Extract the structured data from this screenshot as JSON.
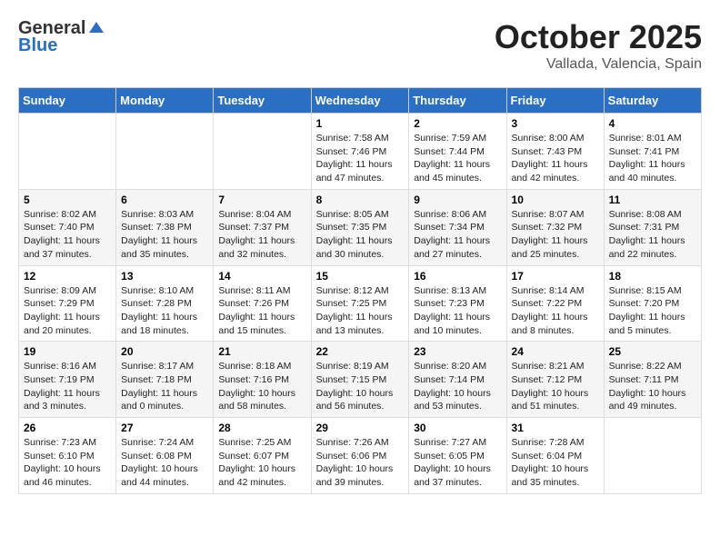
{
  "header": {
    "logo_line1": "General",
    "logo_line2": "Blue",
    "month": "October 2025",
    "location": "Vallada, Valencia, Spain"
  },
  "days_of_week": [
    "Sunday",
    "Monday",
    "Tuesday",
    "Wednesday",
    "Thursday",
    "Friday",
    "Saturday"
  ],
  "weeks": [
    [
      {
        "num": "",
        "sunrise": "",
        "sunset": "",
        "daylight": ""
      },
      {
        "num": "",
        "sunrise": "",
        "sunset": "",
        "daylight": ""
      },
      {
        "num": "",
        "sunrise": "",
        "sunset": "",
        "daylight": ""
      },
      {
        "num": "1",
        "sunrise": "Sunrise: 7:58 AM",
        "sunset": "Sunset: 7:46 PM",
        "daylight": "Daylight: 11 hours and 47 minutes."
      },
      {
        "num": "2",
        "sunrise": "Sunrise: 7:59 AM",
        "sunset": "Sunset: 7:44 PM",
        "daylight": "Daylight: 11 hours and 45 minutes."
      },
      {
        "num": "3",
        "sunrise": "Sunrise: 8:00 AM",
        "sunset": "Sunset: 7:43 PM",
        "daylight": "Daylight: 11 hours and 42 minutes."
      },
      {
        "num": "4",
        "sunrise": "Sunrise: 8:01 AM",
        "sunset": "Sunset: 7:41 PM",
        "daylight": "Daylight: 11 hours and 40 minutes."
      }
    ],
    [
      {
        "num": "5",
        "sunrise": "Sunrise: 8:02 AM",
        "sunset": "Sunset: 7:40 PM",
        "daylight": "Daylight: 11 hours and 37 minutes."
      },
      {
        "num": "6",
        "sunrise": "Sunrise: 8:03 AM",
        "sunset": "Sunset: 7:38 PM",
        "daylight": "Daylight: 11 hours and 35 minutes."
      },
      {
        "num": "7",
        "sunrise": "Sunrise: 8:04 AM",
        "sunset": "Sunset: 7:37 PM",
        "daylight": "Daylight: 11 hours and 32 minutes."
      },
      {
        "num": "8",
        "sunrise": "Sunrise: 8:05 AM",
        "sunset": "Sunset: 7:35 PM",
        "daylight": "Daylight: 11 hours and 30 minutes."
      },
      {
        "num": "9",
        "sunrise": "Sunrise: 8:06 AM",
        "sunset": "Sunset: 7:34 PM",
        "daylight": "Daylight: 11 hours and 27 minutes."
      },
      {
        "num": "10",
        "sunrise": "Sunrise: 8:07 AM",
        "sunset": "Sunset: 7:32 PM",
        "daylight": "Daylight: 11 hours and 25 minutes."
      },
      {
        "num": "11",
        "sunrise": "Sunrise: 8:08 AM",
        "sunset": "Sunset: 7:31 PM",
        "daylight": "Daylight: 11 hours and 22 minutes."
      }
    ],
    [
      {
        "num": "12",
        "sunrise": "Sunrise: 8:09 AM",
        "sunset": "Sunset: 7:29 PM",
        "daylight": "Daylight: 11 hours and 20 minutes."
      },
      {
        "num": "13",
        "sunrise": "Sunrise: 8:10 AM",
        "sunset": "Sunset: 7:28 PM",
        "daylight": "Daylight: 11 hours and 18 minutes."
      },
      {
        "num": "14",
        "sunrise": "Sunrise: 8:11 AM",
        "sunset": "Sunset: 7:26 PM",
        "daylight": "Daylight: 11 hours and 15 minutes."
      },
      {
        "num": "15",
        "sunrise": "Sunrise: 8:12 AM",
        "sunset": "Sunset: 7:25 PM",
        "daylight": "Daylight: 11 hours and 13 minutes."
      },
      {
        "num": "16",
        "sunrise": "Sunrise: 8:13 AM",
        "sunset": "Sunset: 7:23 PM",
        "daylight": "Daylight: 11 hours and 10 minutes."
      },
      {
        "num": "17",
        "sunrise": "Sunrise: 8:14 AM",
        "sunset": "Sunset: 7:22 PM",
        "daylight": "Daylight: 11 hours and 8 minutes."
      },
      {
        "num": "18",
        "sunrise": "Sunrise: 8:15 AM",
        "sunset": "Sunset: 7:20 PM",
        "daylight": "Daylight: 11 hours and 5 minutes."
      }
    ],
    [
      {
        "num": "19",
        "sunrise": "Sunrise: 8:16 AM",
        "sunset": "Sunset: 7:19 PM",
        "daylight": "Daylight: 11 hours and 3 minutes."
      },
      {
        "num": "20",
        "sunrise": "Sunrise: 8:17 AM",
        "sunset": "Sunset: 7:18 PM",
        "daylight": "Daylight: 11 hours and 0 minutes."
      },
      {
        "num": "21",
        "sunrise": "Sunrise: 8:18 AM",
        "sunset": "Sunset: 7:16 PM",
        "daylight": "Daylight: 10 hours and 58 minutes."
      },
      {
        "num": "22",
        "sunrise": "Sunrise: 8:19 AM",
        "sunset": "Sunset: 7:15 PM",
        "daylight": "Daylight: 10 hours and 56 minutes."
      },
      {
        "num": "23",
        "sunrise": "Sunrise: 8:20 AM",
        "sunset": "Sunset: 7:14 PM",
        "daylight": "Daylight: 10 hours and 53 minutes."
      },
      {
        "num": "24",
        "sunrise": "Sunrise: 8:21 AM",
        "sunset": "Sunset: 7:12 PM",
        "daylight": "Daylight: 10 hours and 51 minutes."
      },
      {
        "num": "25",
        "sunrise": "Sunrise: 8:22 AM",
        "sunset": "Sunset: 7:11 PM",
        "daylight": "Daylight: 10 hours and 49 minutes."
      }
    ],
    [
      {
        "num": "26",
        "sunrise": "Sunrise: 7:23 AM",
        "sunset": "Sunset: 6:10 PM",
        "daylight": "Daylight: 10 hours and 46 minutes."
      },
      {
        "num": "27",
        "sunrise": "Sunrise: 7:24 AM",
        "sunset": "Sunset: 6:08 PM",
        "daylight": "Daylight: 10 hours and 44 minutes."
      },
      {
        "num": "28",
        "sunrise": "Sunrise: 7:25 AM",
        "sunset": "Sunset: 6:07 PM",
        "daylight": "Daylight: 10 hours and 42 minutes."
      },
      {
        "num": "29",
        "sunrise": "Sunrise: 7:26 AM",
        "sunset": "Sunset: 6:06 PM",
        "daylight": "Daylight: 10 hours and 39 minutes."
      },
      {
        "num": "30",
        "sunrise": "Sunrise: 7:27 AM",
        "sunset": "Sunset: 6:05 PM",
        "daylight": "Daylight: 10 hours and 37 minutes."
      },
      {
        "num": "31",
        "sunrise": "Sunrise: 7:28 AM",
        "sunset": "Sunset: 6:04 PM",
        "daylight": "Daylight: 10 hours and 35 minutes."
      },
      {
        "num": "",
        "sunrise": "",
        "sunset": "",
        "daylight": ""
      }
    ]
  ]
}
